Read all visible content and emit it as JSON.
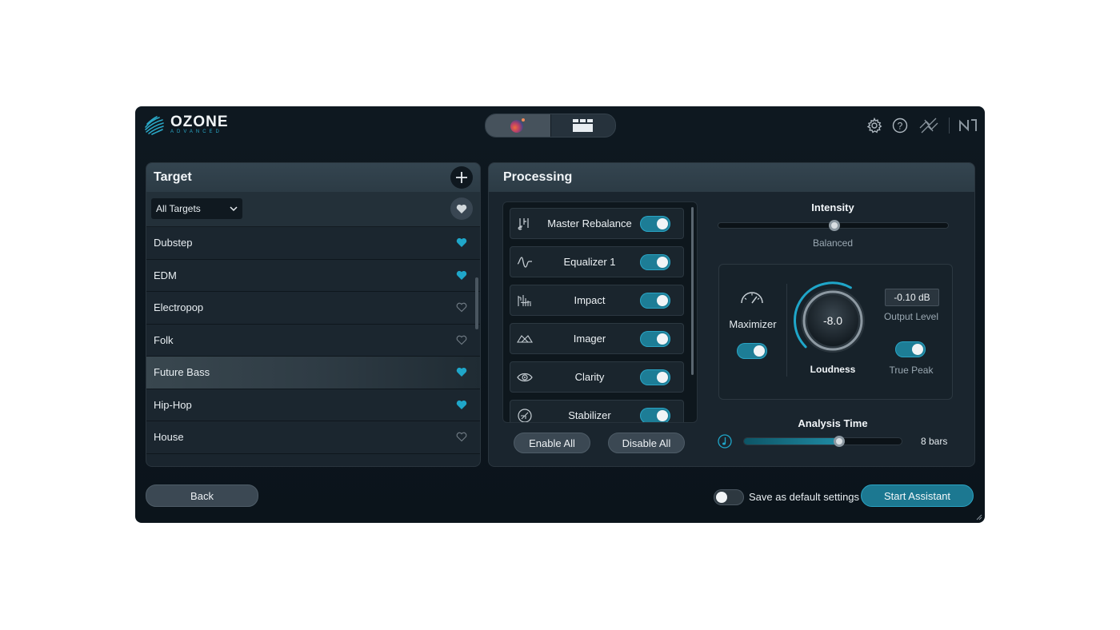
{
  "app": {
    "logo_title": "OZONE",
    "logo_subtitle": "ADVANCED",
    "modes": [
      "assistant-mode",
      "module-mode"
    ],
    "accent_color": "#1f8aa3",
    "header_icons": [
      "settings-icon",
      "help-icon",
      "izotope-link-icon",
      "native-instruments-logo"
    ]
  },
  "target": {
    "title": "Target",
    "filter_selected": "All Targets",
    "items": [
      {
        "label": "Dubstep",
        "favorite": true
      },
      {
        "label": "EDM",
        "favorite": true
      },
      {
        "label": "Electropop",
        "favorite": false
      },
      {
        "label": "Folk",
        "favorite": false
      },
      {
        "label": "Future Bass",
        "favorite": true,
        "selected": true
      },
      {
        "label": "Hip-Hop",
        "favorite": true
      },
      {
        "label": "House",
        "favorite": false
      }
    ]
  },
  "processing": {
    "title": "Processing",
    "modules": [
      {
        "label": "Master Rebalance",
        "enabled": true,
        "icon": "rebalance-icon"
      },
      {
        "label": "Equalizer 1",
        "enabled": true,
        "icon": "equalizer-icon"
      },
      {
        "label": "Impact",
        "enabled": true,
        "icon": "impact-icon"
      },
      {
        "label": "Imager",
        "enabled": true,
        "icon": "imager-icon"
      },
      {
        "label": "Clarity",
        "enabled": true,
        "icon": "clarity-icon"
      },
      {
        "label": "Stabilizer",
        "enabled": true,
        "icon": "stabilizer-icon"
      }
    ],
    "enable_all": "Enable All",
    "disable_all": "Disable All",
    "intensity": {
      "label": "Intensity",
      "value_label": "Balanced",
      "position": 0.5
    },
    "maximizer": {
      "label": "Maximizer",
      "enabled": true,
      "loudness_label": "Loudness",
      "loudness_value": "-8.0",
      "output_level_value": "-0.10 dB",
      "output_level_label": "Output Level",
      "true_peak_label": "True Peak",
      "true_peak_enabled": true
    },
    "analysis": {
      "label": "Analysis Time",
      "value_label": "8 bars",
      "position": 0.6
    }
  },
  "footer": {
    "back_label": "Back",
    "save_default_label": "Save as default settings",
    "save_default_enabled": false,
    "start_label": "Start Assistant"
  }
}
